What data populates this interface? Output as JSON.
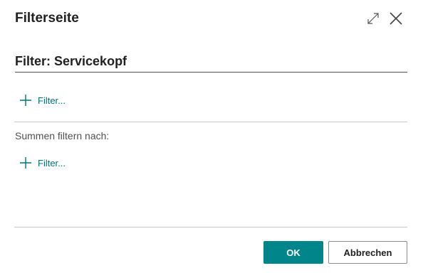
{
  "dialog": {
    "title": "Filterseite",
    "expand_icon": "expand-icon",
    "close_icon": "close-icon"
  },
  "filter_section": {
    "title": "Filter: Servicekopf",
    "add_filter_label": "Filter..."
  },
  "totals_section": {
    "label": "Summen filtern nach:",
    "add_filter_label": "Filter..."
  },
  "footer": {
    "ok_label": "OK",
    "cancel_label": "Abbrechen"
  },
  "colors": {
    "accent": "#00858a",
    "link": "#00757a"
  }
}
